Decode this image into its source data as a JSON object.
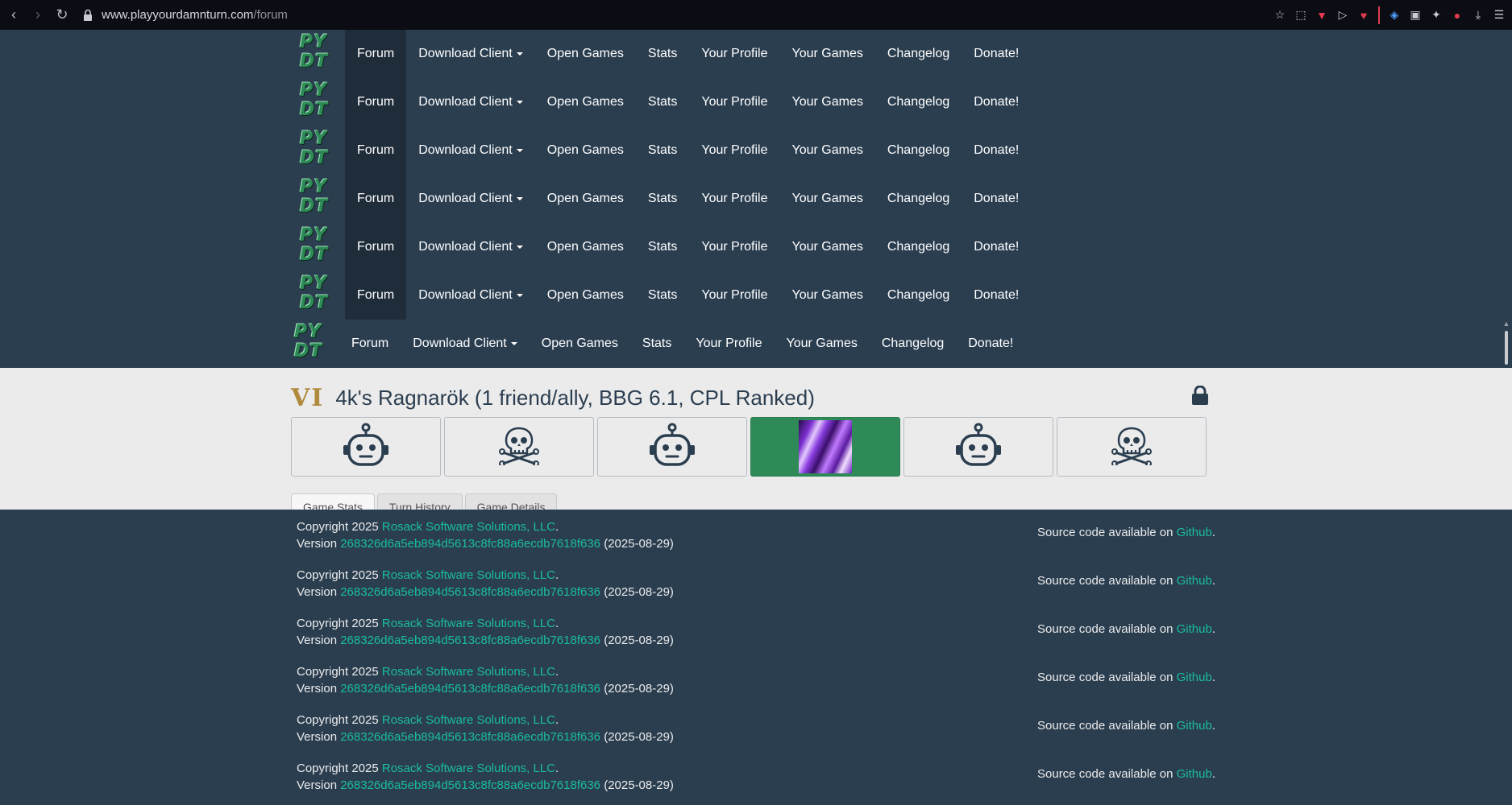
{
  "browser": {
    "url_host": "www.playyourdamnturn.com",
    "url_path": "/forum"
  },
  "site": {
    "logo_line1": "PY",
    "logo_line2": "DT"
  },
  "nav": {
    "items": [
      {
        "label": "Forum",
        "active": true
      },
      {
        "label": "Download Client",
        "dropdown": true
      },
      {
        "label": "Open Games"
      },
      {
        "label": "Stats"
      },
      {
        "label": "Your Profile"
      },
      {
        "label": "Your Games"
      },
      {
        "label": "Changelog"
      },
      {
        "label": "Donate!"
      }
    ],
    "repeat_rows": 7
  },
  "game": {
    "civ_badge": "VI",
    "title": "4k's Ragnarök (1 friend/ally, BBG 6.1, CPL Ranked)",
    "players": [
      {
        "icon": "robot-icon"
      },
      {
        "icon": "skull-crossbones-icon"
      },
      {
        "icon": "robot-icon"
      },
      {
        "icon": "player-avatar",
        "active": true
      },
      {
        "icon": "robot-icon"
      },
      {
        "icon": "skull-crossbones-icon"
      }
    ],
    "tabs": [
      "Game Stats",
      "Turn History",
      "Game Details"
    ]
  },
  "footer": {
    "copyright_prefix": "Copyright 2025 ",
    "company": "Rosack Software Solutions, LLC",
    "period": ".",
    "version_prefix": "Version ",
    "version_hash": "268326d6a5eb894d5613c8fc88a6ecdb7618f636",
    "version_date": " (2025-08-29)",
    "source_prefix": "Source code available on ",
    "source_link": "Github",
    "source_suffix": ".",
    "repeat_rows": 6
  },
  "colors": {
    "navbar_bg": "#2b3e50",
    "active_nav_bg": "#1f2d3a",
    "accent_green": "#2e8b57",
    "link": "#1abc9c"
  }
}
